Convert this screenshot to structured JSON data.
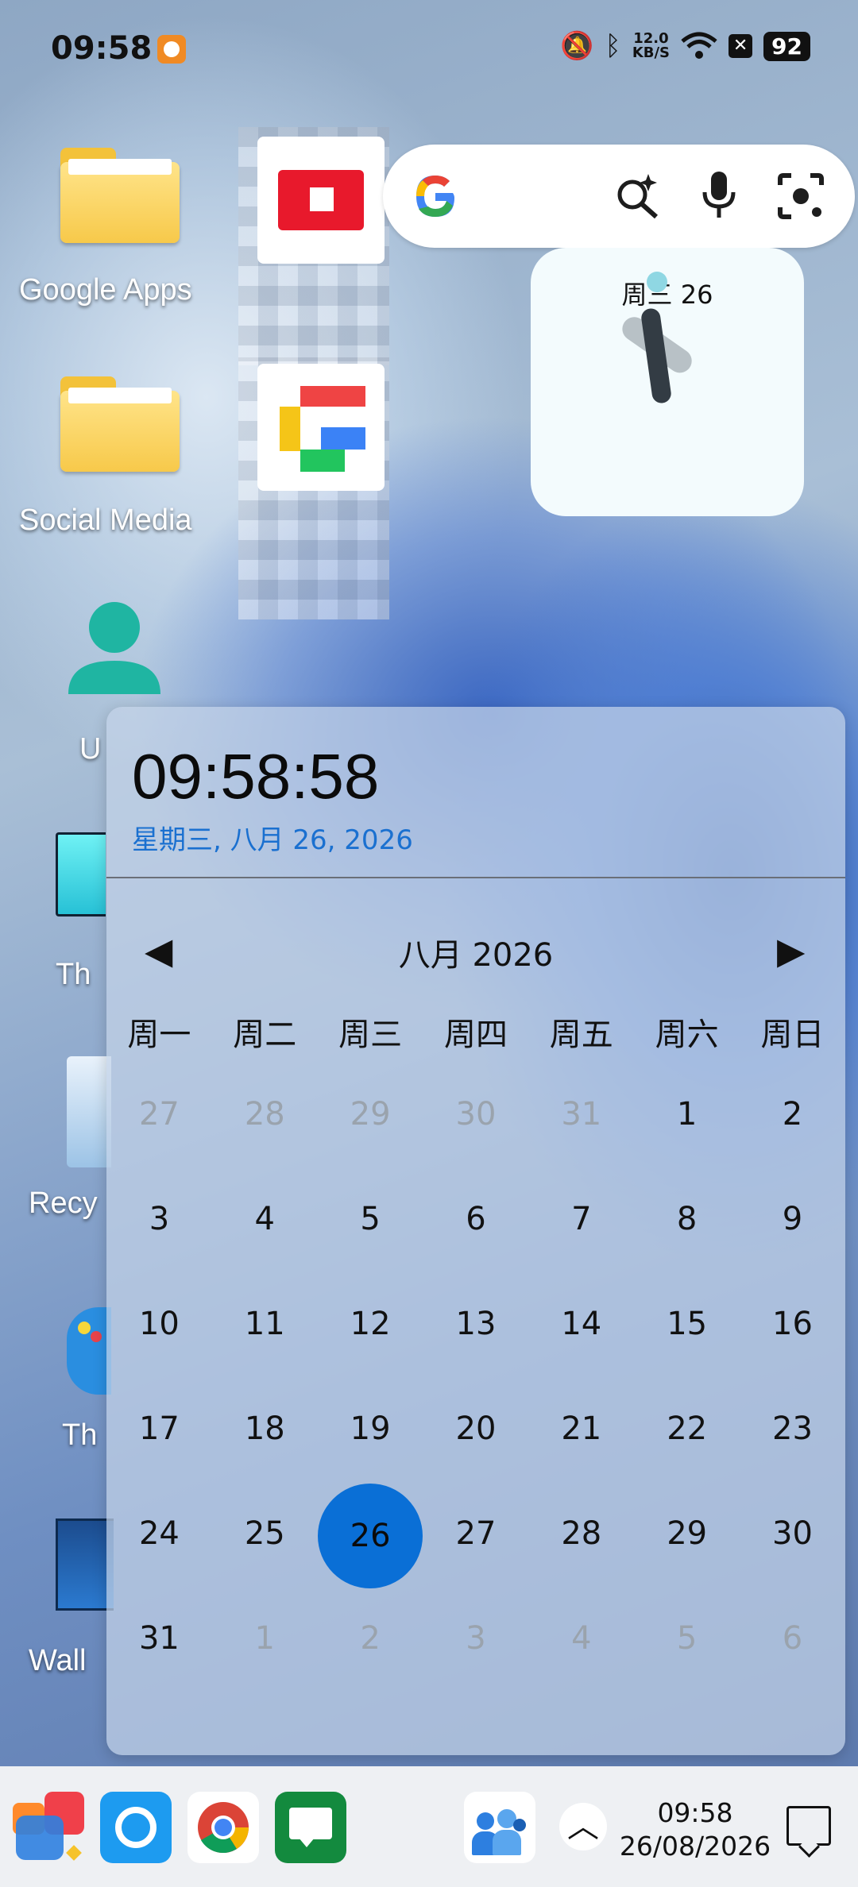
{
  "status_bar": {
    "time": "09:58",
    "net_speed_value": "12.0",
    "net_speed_unit": "KB/S",
    "battery": "92",
    "icons": [
      "app-notification-icon",
      "mute-bell-icon",
      "bluetooth-icon",
      "wifi-icon",
      "x-icon"
    ]
  },
  "desktop": {
    "icons": [
      {
        "label": "Google Apps",
        "icon": "folder-icon"
      },
      {
        "label": "Social Media",
        "icon": "folder-icon"
      },
      {
        "label": "U",
        "icon": "user-icon"
      },
      {
        "label": "Th",
        "icon": "monitor-icon"
      },
      {
        "label": "Recy",
        "icon": "recycle-bin-icon"
      },
      {
        "label": "Th",
        "icon": "theme-palette-icon"
      },
      {
        "label": "Wall",
        "icon": "wallpaper-icon"
      }
    ]
  },
  "search_widget": {
    "logo": "G",
    "icons": [
      "google-logo-icon",
      "ai-search-icon",
      "microphone-icon",
      "lens-camera-icon"
    ]
  },
  "clock_widget": {
    "date": "周三 26"
  },
  "calendar": {
    "time": "09:58:58",
    "full_date": "星期三, 八月 26, 2026",
    "month_title": "八月 2026",
    "weekdays": [
      "周一",
      "周二",
      "周三",
      "周四",
      "周五",
      "周六",
      "周日"
    ],
    "weeks": [
      [
        {
          "d": "27",
          "m": true
        },
        {
          "d": "28",
          "m": true
        },
        {
          "d": "29",
          "m": true
        },
        {
          "d": "30",
          "m": true
        },
        {
          "d": "31",
          "m": true
        },
        {
          "d": "1"
        },
        {
          "d": "2"
        }
      ],
      [
        {
          "d": "3"
        },
        {
          "d": "4"
        },
        {
          "d": "5"
        },
        {
          "d": "6"
        },
        {
          "d": "7"
        },
        {
          "d": "8"
        },
        {
          "d": "9"
        }
      ],
      [
        {
          "d": "10"
        },
        {
          "d": "11"
        },
        {
          "d": "12"
        },
        {
          "d": "13"
        },
        {
          "d": "14"
        },
        {
          "d": "15"
        },
        {
          "d": "16"
        }
      ],
      [
        {
          "d": "17"
        },
        {
          "d": "18"
        },
        {
          "d": "19"
        },
        {
          "d": "20"
        },
        {
          "d": "21"
        },
        {
          "d": "22"
        },
        {
          "d": "23"
        }
      ],
      [
        {
          "d": "24"
        },
        {
          "d": "25"
        },
        {
          "d": "26",
          "today": true
        },
        {
          "d": "27"
        },
        {
          "d": "28"
        },
        {
          "d": "29"
        },
        {
          "d": "30"
        }
      ],
      [
        {
          "d": "31"
        },
        {
          "d": "1",
          "m": true
        },
        {
          "d": "2",
          "m": true
        },
        {
          "d": "3",
          "m": true
        },
        {
          "d": "4",
          "m": true
        },
        {
          "d": "5",
          "m": true
        },
        {
          "d": "6",
          "m": true
        }
      ]
    ],
    "accent_color": "#0a6fd6"
  },
  "taskbar": {
    "time": "09:58",
    "date": "26/08/2026",
    "apps": [
      "start-menu-icon",
      "cortana-icon",
      "chrome-icon",
      "messages-icon",
      "people-icon"
    ]
  }
}
